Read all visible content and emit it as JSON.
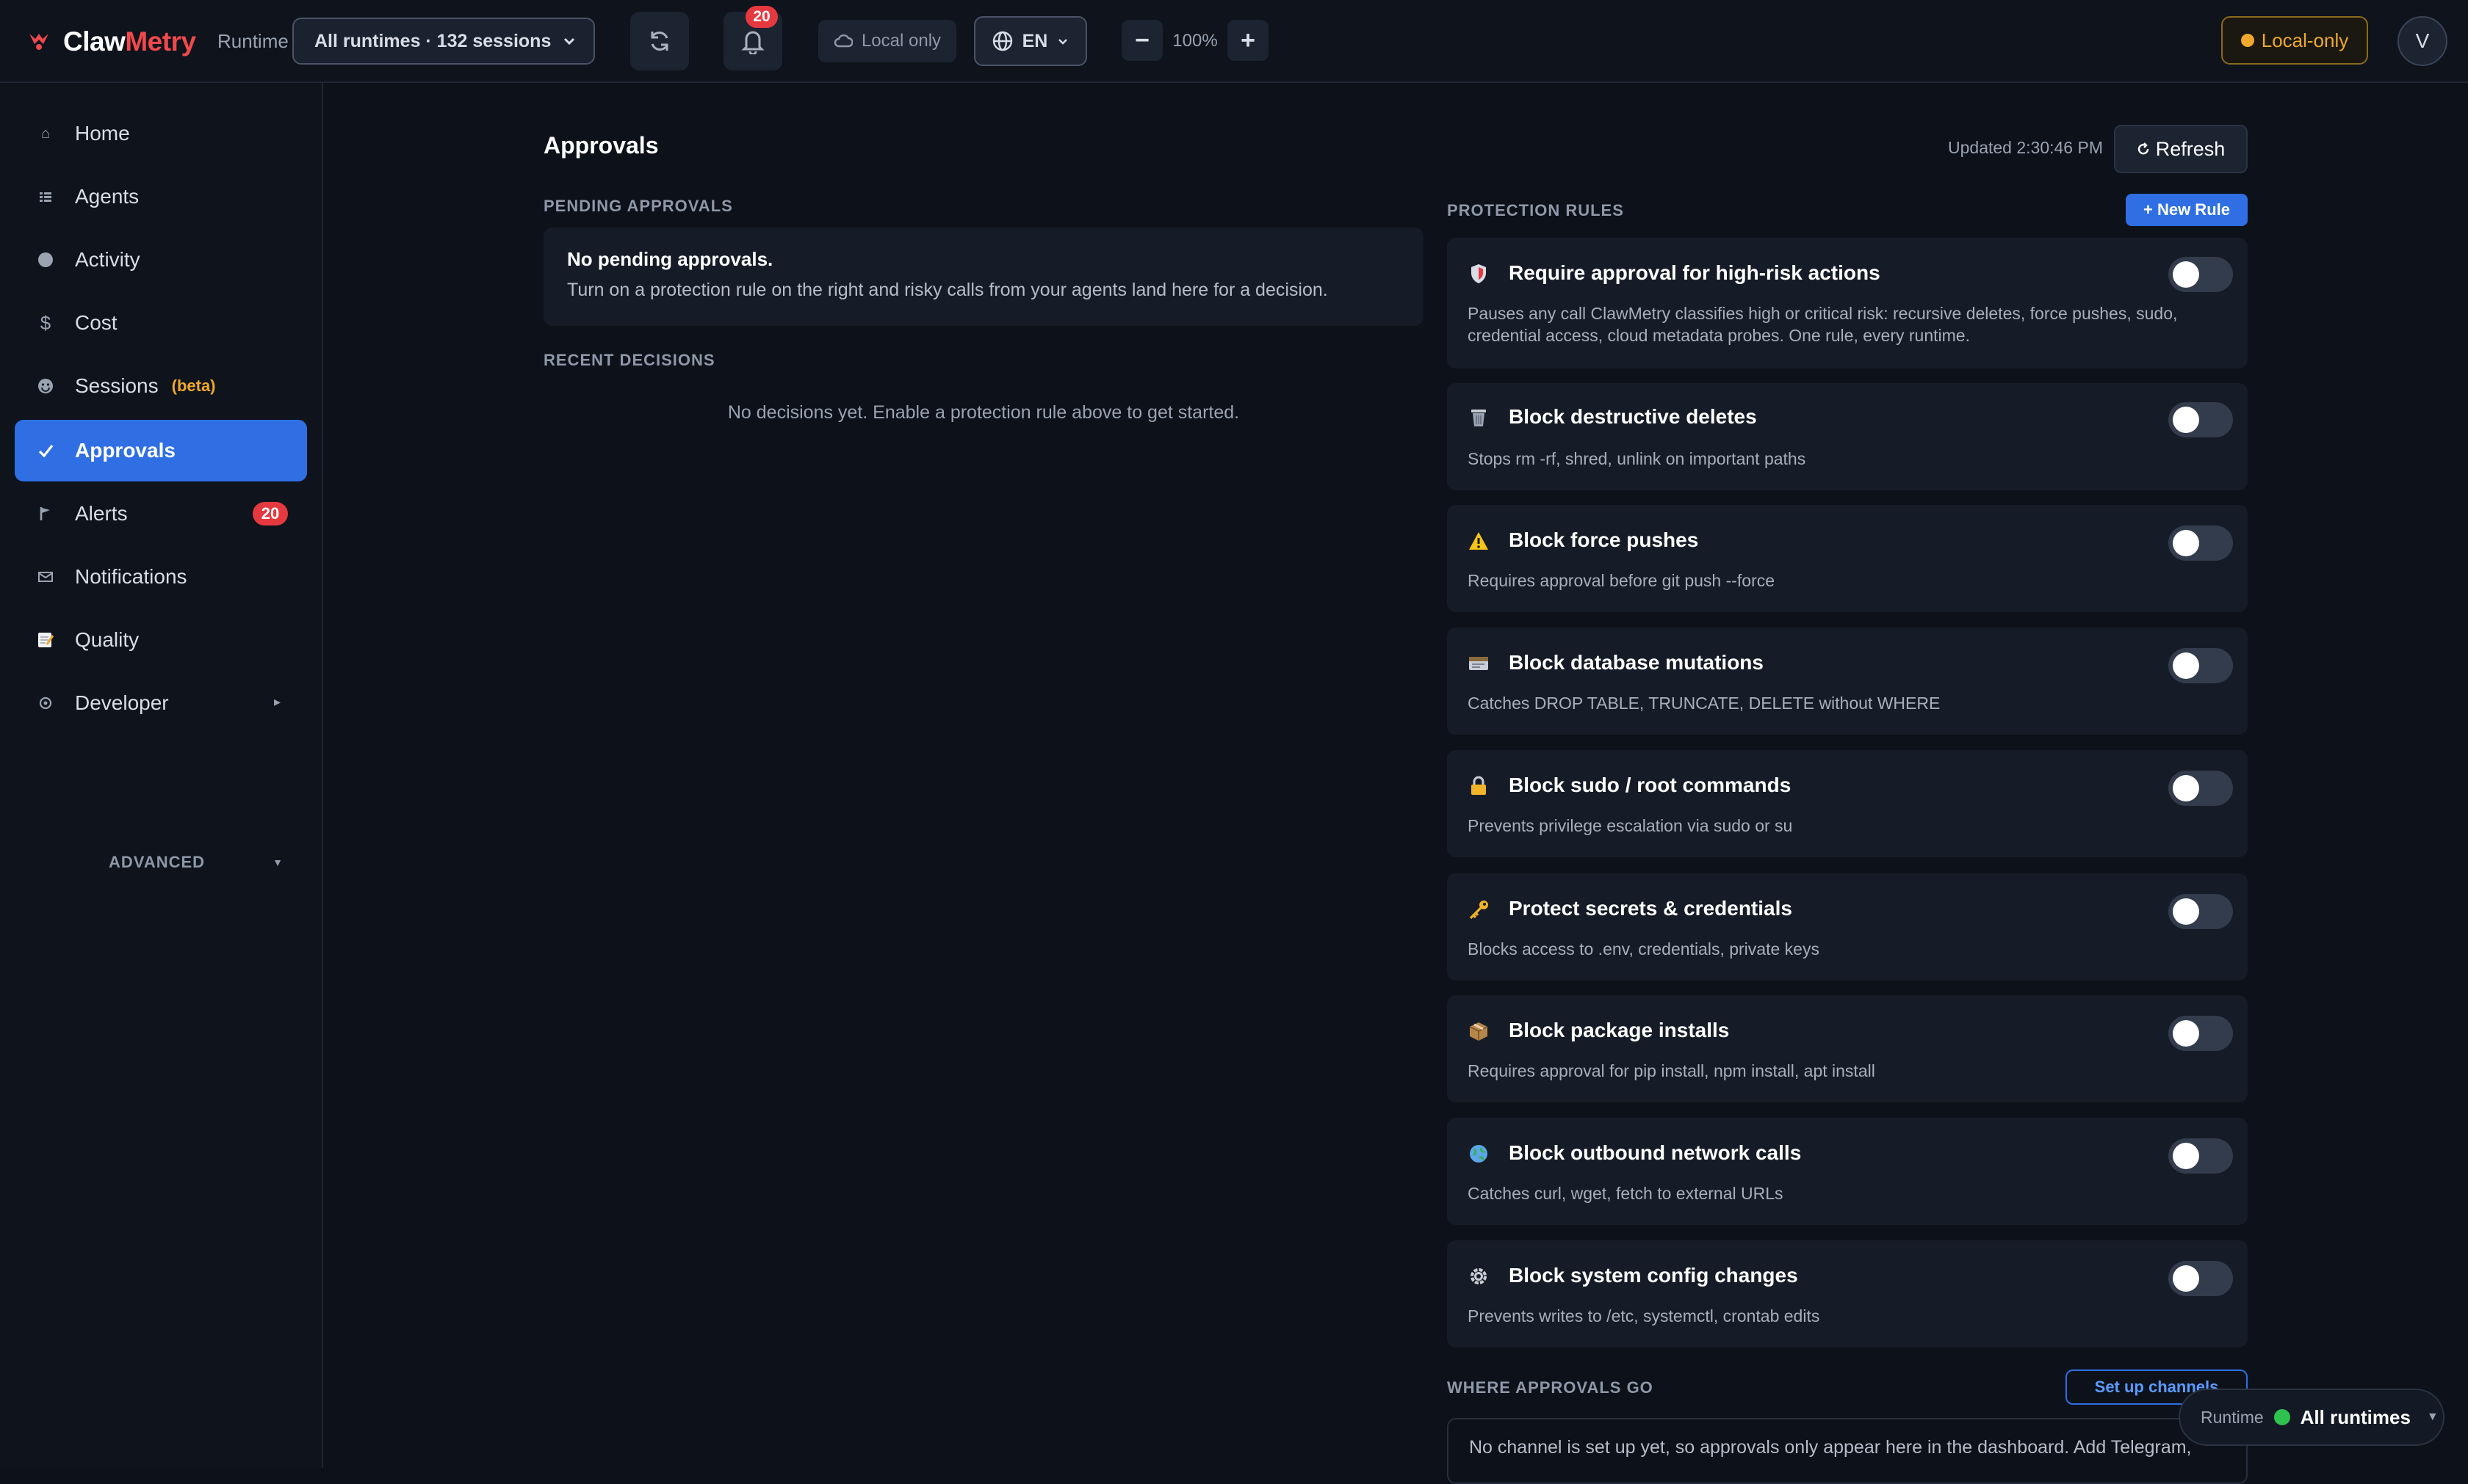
{
  "header": {
    "logo_part1": "Claw",
    "logo_part2": "Metry",
    "runtime_label": "Runtime",
    "runtime_select": "All runtimes · 132 sessions",
    "notifications_count": "20",
    "local_pill": "Local only",
    "language": "EN",
    "zoom_out": "−",
    "zoom_value": "100%",
    "zoom_in": "+",
    "local_only_button": "Local-only",
    "avatar_initial": "V"
  },
  "sidebar": {
    "items": [
      {
        "label": "Home"
      },
      {
        "label": "Agents"
      },
      {
        "label": "Activity"
      },
      {
        "label": "Cost"
      },
      {
        "label": "Sessions",
        "tag": "(beta)"
      },
      {
        "label": "Approvals"
      },
      {
        "label": "Alerts",
        "badge": "20"
      },
      {
        "label": "Notifications"
      },
      {
        "label": "Quality"
      },
      {
        "label": "Developer"
      }
    ],
    "advanced": "ADVANCED"
  },
  "main": {
    "title": "Approvals",
    "updated": "Updated 2:30:46 PM",
    "refresh": "Refresh",
    "pending_heading": "PENDING APPROVALS",
    "pending_title": "No pending approvals.",
    "pending_text": "Turn on a protection rule on the right and risky calls from your agents land here for a decision.",
    "recent_heading": "RECENT DECISIONS",
    "recent_empty": "No decisions yet. Enable a protection rule above to get started.",
    "rules_heading": "PROTECTION RULES",
    "new_rule": "+ New Rule",
    "rules": [
      {
        "title": "Require approval for high-risk actions",
        "desc": "Pauses any call ClawMetry classifies high or critical risk: recursive deletes, force pushes, sudo, credential access, cloud metadata probes. One rule, every runtime.",
        "enabled": false
      },
      {
        "title": "Block destructive deletes",
        "desc": "Stops rm -rf, shred, unlink on important paths",
        "enabled": false
      },
      {
        "title": "Block force pushes",
        "desc": "Requires approval before git push --force",
        "enabled": false
      },
      {
        "title": "Block database mutations",
        "desc": "Catches DROP TABLE, TRUNCATE, DELETE without WHERE",
        "enabled": false
      },
      {
        "title": "Block sudo / root commands",
        "desc": "Prevents privilege escalation via sudo or su",
        "enabled": false
      },
      {
        "title": "Protect secrets & credentials",
        "desc": "Blocks access to .env, credentials, private keys",
        "enabled": false
      },
      {
        "title": "Block package installs",
        "desc": "Requires approval for pip install, npm install, apt install",
        "enabled": false
      },
      {
        "title": "Block outbound network calls",
        "desc": "Catches curl, wget, fetch to external URLs",
        "enabled": false
      },
      {
        "title": "Block system config changes",
        "desc": "Prevents writes to /etc, systemctl, crontab edits",
        "enabled": false
      }
    ],
    "where_heading": "WHERE APPROVALS GO",
    "setup_channels": "Set up channels",
    "channel_text": "No channel is set up yet, so approvals only appear here in the dashboard. Add Telegram,"
  },
  "runtime_float": {
    "label": "Runtime",
    "value": "All runtimes"
  },
  "colors": {
    "accent": "#2f6fe3",
    "brand_red": "#f0494c",
    "warning": "#f0a92c",
    "badge": "#e5393f",
    "online": "#2fc24f"
  }
}
